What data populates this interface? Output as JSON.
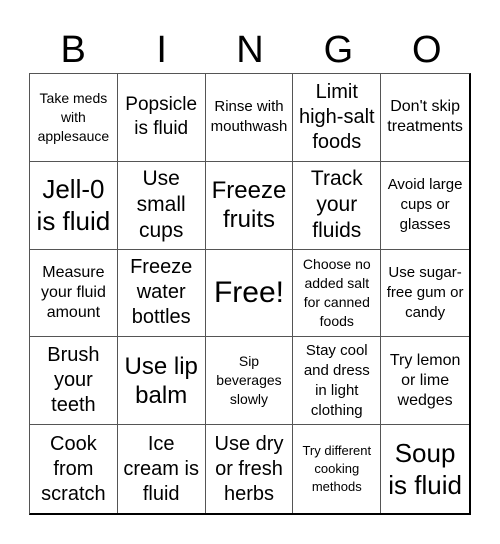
{
  "card": {
    "header": [
      "B",
      "I",
      "N",
      "G",
      "O"
    ],
    "cells": [
      "Take meds with applesauce",
      "Popsicle is fluid",
      "Rinse with mouthwash",
      "Limit high-salt foods",
      "Don't skip treatments",
      "Jell-0 is fluid",
      "Use small cups",
      "Freeze fruits",
      "Track your fluids",
      "Avoid large cups or glasses",
      "Measure your fluid amount",
      "Freeze water bottles",
      "Free!",
      "Choose no added salt for canned foods",
      "Use sugar-free gum or candy",
      "Brush your teeth",
      "Use lip balm",
      "Sip beverages slowly",
      "Stay cool and dress in light clothing",
      "Try lemon or lime wedges",
      "Cook from scratch",
      "Ice cream is fluid",
      "Use dry or fresh herbs",
      "Try different cooking methods",
      "Soup is fluid"
    ]
  }
}
